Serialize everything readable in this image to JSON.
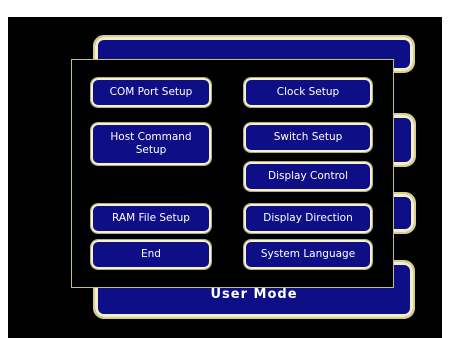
{
  "footer": {
    "mode_label": "User Mode"
  },
  "menu": {
    "com_port_setup": "COM Port Setup",
    "host_command_setup": "Host Command Setup",
    "ram_file_setup": "RAM File Setup",
    "end": "End",
    "clock_setup": "Clock Setup",
    "switch_setup": "Switch Setup",
    "display_control": "Display Control",
    "display_direction": "Display Direction",
    "system_language": "System Language"
  },
  "colors": {
    "screen_background": "#000000",
    "button_fill": "#0e0e86",
    "button_border": "#f4f1d6",
    "menu_border": "#c9c06a",
    "text": "#ffffff"
  }
}
